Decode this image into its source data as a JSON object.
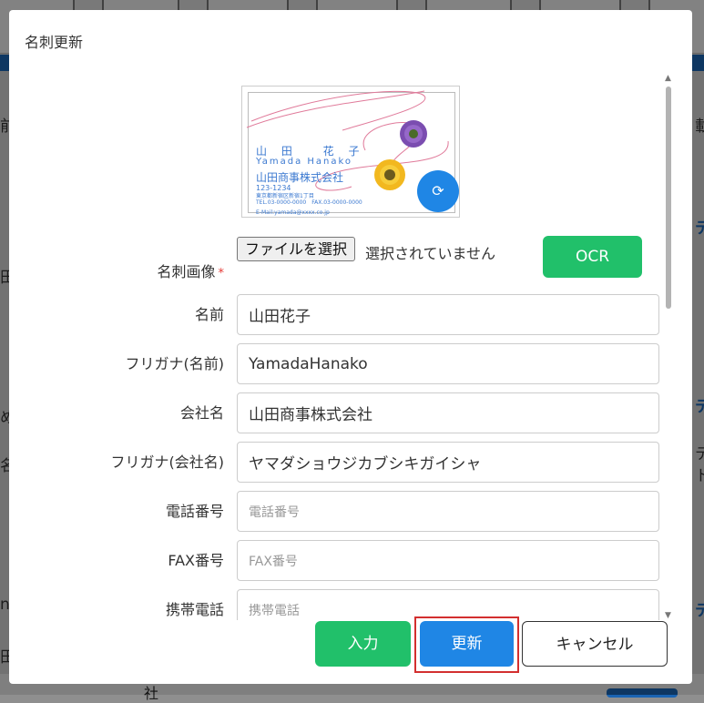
{
  "modal": {
    "title": "名刺更新"
  },
  "card_image": {
    "name": "山 田　 花 子",
    "romaji": "Yamada Hanako",
    "company": "山田商事株式会社",
    "zip": "123-1234",
    "address": "東京都新宿区新宿1丁目",
    "phone_fax": "TEL.03-0000-0000　FAX.03-0000-0000",
    "email": "E-Mail:yamada@xxxx.co.jp",
    "rotate_icon": "rotate-icon"
  },
  "form": {
    "image_label": "名刺画像",
    "required_mark": "*",
    "file_button": "ファイルを選択",
    "file_status": "選択されていません",
    "ocr_button": "OCR",
    "fields": [
      {
        "label": "名前",
        "value": "山田花子",
        "placeholder": ""
      },
      {
        "label": "フリガナ(名前)",
        "value": "YamadaHanako",
        "placeholder": ""
      },
      {
        "label": "会社名",
        "value": "山田商事株式会社",
        "placeholder": ""
      },
      {
        "label": "フリガナ(会社名)",
        "value": "ヤマダショウジカブシキガイシャ",
        "placeholder": ""
      },
      {
        "label": "電話番号",
        "value": "",
        "placeholder": "電話番号"
      },
      {
        "label": "FAX番号",
        "value": "",
        "placeholder": "FAX番号"
      },
      {
        "label": "携帯電話",
        "value": "",
        "placeholder": "携帯電話"
      }
    ]
  },
  "footer": {
    "input_button": "入力",
    "update_button": "更新",
    "cancel_button": "キャンセル"
  },
  "background": {
    "left_fragments": [
      "前",
      "田",
      "め",
      "名",
      "n",
      "田"
    ],
    "right_fragments": [
      "載",
      "テ",
      "テ",
      "テ",
      "ト",
      "テ"
    ],
    "bottom_text": "社"
  },
  "colors": {
    "primary": "#1f86e5",
    "success": "#21c06a",
    "highlight": "#d32f2f",
    "header_blue": "#1a64b3"
  }
}
